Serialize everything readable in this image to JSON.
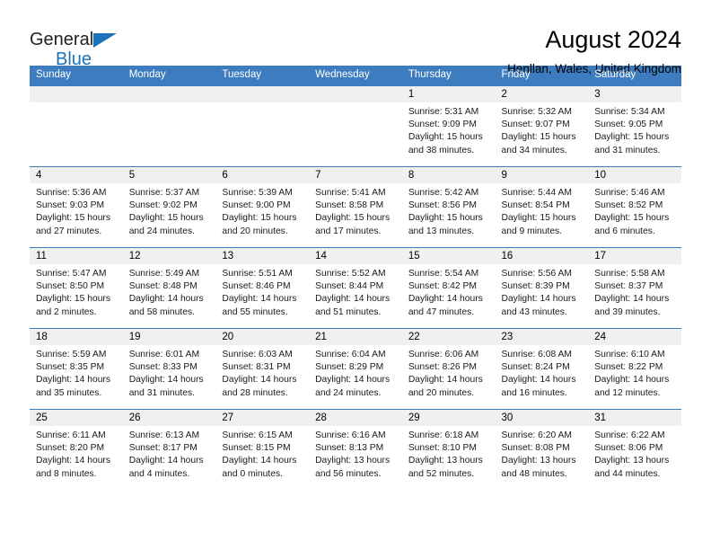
{
  "brand": {
    "name_top": "General",
    "name_bottom": "Blue",
    "triangle_color": "#1b74bb"
  },
  "header": {
    "title": "August 2024",
    "subtitle": "Henllan, Wales, United Kingdom"
  },
  "theme": {
    "header_bg": "#3d7dbf",
    "daynum_bg": "#f0f0f0",
    "grid_line": "#3d7dbf"
  },
  "weekdays": [
    "Sunday",
    "Monday",
    "Tuesday",
    "Wednesday",
    "Thursday",
    "Friday",
    "Saturday"
  ],
  "weeks": [
    [
      {
        "day": "",
        "lines": []
      },
      {
        "day": "",
        "lines": []
      },
      {
        "day": "",
        "lines": []
      },
      {
        "day": "",
        "lines": []
      },
      {
        "day": "1",
        "lines": [
          "Sunrise: 5:31 AM",
          "Sunset: 9:09 PM",
          "Daylight: 15 hours",
          "and 38 minutes."
        ]
      },
      {
        "day": "2",
        "lines": [
          "Sunrise: 5:32 AM",
          "Sunset: 9:07 PM",
          "Daylight: 15 hours",
          "and 34 minutes."
        ]
      },
      {
        "day": "3",
        "lines": [
          "Sunrise: 5:34 AM",
          "Sunset: 9:05 PM",
          "Daylight: 15 hours",
          "and 31 minutes."
        ]
      }
    ],
    [
      {
        "day": "4",
        "lines": [
          "Sunrise: 5:36 AM",
          "Sunset: 9:03 PM",
          "Daylight: 15 hours",
          "and 27 minutes."
        ]
      },
      {
        "day": "5",
        "lines": [
          "Sunrise: 5:37 AM",
          "Sunset: 9:02 PM",
          "Daylight: 15 hours",
          "and 24 minutes."
        ]
      },
      {
        "day": "6",
        "lines": [
          "Sunrise: 5:39 AM",
          "Sunset: 9:00 PM",
          "Daylight: 15 hours",
          "and 20 minutes."
        ]
      },
      {
        "day": "7",
        "lines": [
          "Sunrise: 5:41 AM",
          "Sunset: 8:58 PM",
          "Daylight: 15 hours",
          "and 17 minutes."
        ]
      },
      {
        "day": "8",
        "lines": [
          "Sunrise: 5:42 AM",
          "Sunset: 8:56 PM",
          "Daylight: 15 hours",
          "and 13 minutes."
        ]
      },
      {
        "day": "9",
        "lines": [
          "Sunrise: 5:44 AM",
          "Sunset: 8:54 PM",
          "Daylight: 15 hours",
          "and 9 minutes."
        ]
      },
      {
        "day": "10",
        "lines": [
          "Sunrise: 5:46 AM",
          "Sunset: 8:52 PM",
          "Daylight: 15 hours",
          "and 6 minutes."
        ]
      }
    ],
    [
      {
        "day": "11",
        "lines": [
          "Sunrise: 5:47 AM",
          "Sunset: 8:50 PM",
          "Daylight: 15 hours",
          "and 2 minutes."
        ]
      },
      {
        "day": "12",
        "lines": [
          "Sunrise: 5:49 AM",
          "Sunset: 8:48 PM",
          "Daylight: 14 hours",
          "and 58 minutes."
        ]
      },
      {
        "day": "13",
        "lines": [
          "Sunrise: 5:51 AM",
          "Sunset: 8:46 PM",
          "Daylight: 14 hours",
          "and 55 minutes."
        ]
      },
      {
        "day": "14",
        "lines": [
          "Sunrise: 5:52 AM",
          "Sunset: 8:44 PM",
          "Daylight: 14 hours",
          "and 51 minutes."
        ]
      },
      {
        "day": "15",
        "lines": [
          "Sunrise: 5:54 AM",
          "Sunset: 8:42 PM",
          "Daylight: 14 hours",
          "and 47 minutes."
        ]
      },
      {
        "day": "16",
        "lines": [
          "Sunrise: 5:56 AM",
          "Sunset: 8:39 PM",
          "Daylight: 14 hours",
          "and 43 minutes."
        ]
      },
      {
        "day": "17",
        "lines": [
          "Sunrise: 5:58 AM",
          "Sunset: 8:37 PM",
          "Daylight: 14 hours",
          "and 39 minutes."
        ]
      }
    ],
    [
      {
        "day": "18",
        "lines": [
          "Sunrise: 5:59 AM",
          "Sunset: 8:35 PM",
          "Daylight: 14 hours",
          "and 35 minutes."
        ]
      },
      {
        "day": "19",
        "lines": [
          "Sunrise: 6:01 AM",
          "Sunset: 8:33 PM",
          "Daylight: 14 hours",
          "and 31 minutes."
        ]
      },
      {
        "day": "20",
        "lines": [
          "Sunrise: 6:03 AM",
          "Sunset: 8:31 PM",
          "Daylight: 14 hours",
          "and 28 minutes."
        ]
      },
      {
        "day": "21",
        "lines": [
          "Sunrise: 6:04 AM",
          "Sunset: 8:29 PM",
          "Daylight: 14 hours",
          "and 24 minutes."
        ]
      },
      {
        "day": "22",
        "lines": [
          "Sunrise: 6:06 AM",
          "Sunset: 8:26 PM",
          "Daylight: 14 hours",
          "and 20 minutes."
        ]
      },
      {
        "day": "23",
        "lines": [
          "Sunrise: 6:08 AM",
          "Sunset: 8:24 PM",
          "Daylight: 14 hours",
          "and 16 minutes."
        ]
      },
      {
        "day": "24",
        "lines": [
          "Sunrise: 6:10 AM",
          "Sunset: 8:22 PM",
          "Daylight: 14 hours",
          "and 12 minutes."
        ]
      }
    ],
    [
      {
        "day": "25",
        "lines": [
          "Sunrise: 6:11 AM",
          "Sunset: 8:20 PM",
          "Daylight: 14 hours",
          "and 8 minutes."
        ]
      },
      {
        "day": "26",
        "lines": [
          "Sunrise: 6:13 AM",
          "Sunset: 8:17 PM",
          "Daylight: 14 hours",
          "and 4 minutes."
        ]
      },
      {
        "day": "27",
        "lines": [
          "Sunrise: 6:15 AM",
          "Sunset: 8:15 PM",
          "Daylight: 14 hours",
          "and 0 minutes."
        ]
      },
      {
        "day": "28",
        "lines": [
          "Sunrise: 6:16 AM",
          "Sunset: 8:13 PM",
          "Daylight: 13 hours",
          "and 56 minutes."
        ]
      },
      {
        "day": "29",
        "lines": [
          "Sunrise: 6:18 AM",
          "Sunset: 8:10 PM",
          "Daylight: 13 hours",
          "and 52 minutes."
        ]
      },
      {
        "day": "30",
        "lines": [
          "Sunrise: 6:20 AM",
          "Sunset: 8:08 PM",
          "Daylight: 13 hours",
          "and 48 minutes."
        ]
      },
      {
        "day": "31",
        "lines": [
          "Sunrise: 6:22 AM",
          "Sunset: 8:06 PM",
          "Daylight: 13 hours",
          "and 44 minutes."
        ]
      }
    ]
  ]
}
